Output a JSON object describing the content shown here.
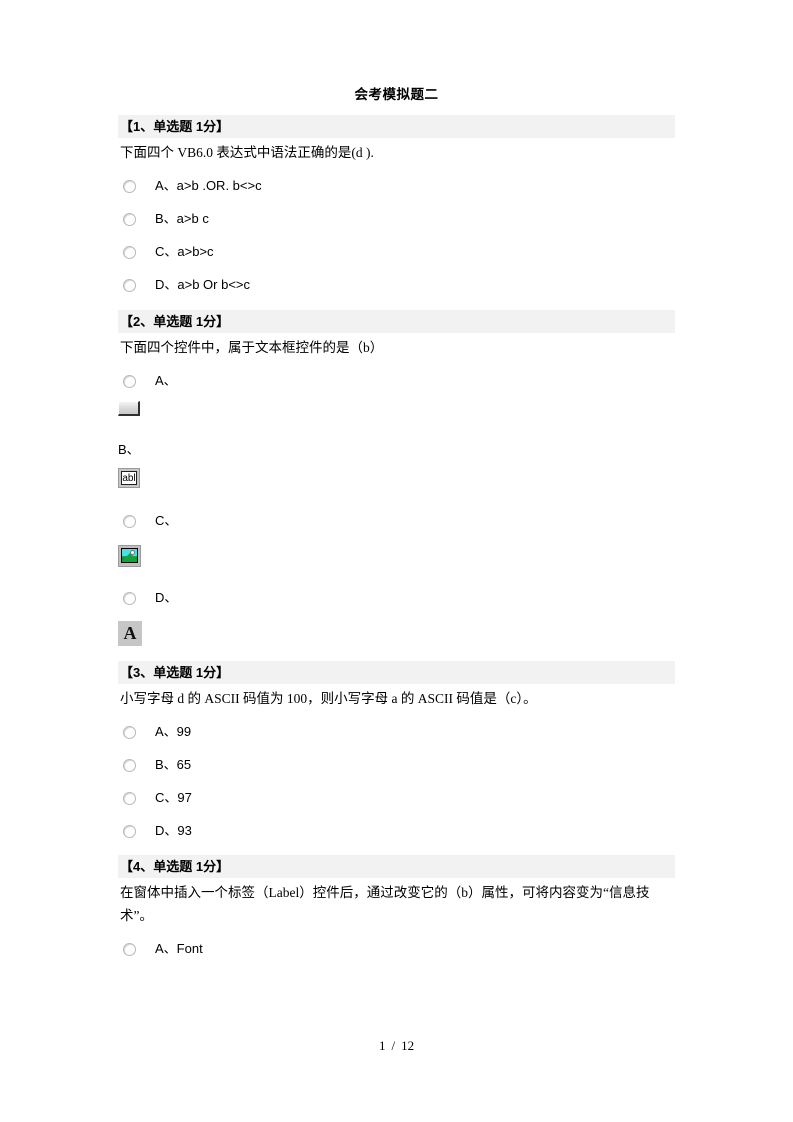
{
  "document": {
    "title": "会考模拟题二",
    "page_footer": {
      "current": "1",
      "separator": "/",
      "total": "12"
    }
  },
  "questions": [
    {
      "header": "【1、单选题 1分】",
      "text": "下面四个 VB6.0 表达式中语法正确的是(d ).",
      "options": [
        {
          "label": "A、a>b .OR. b<>c",
          "type": "radio"
        },
        {
          "label": "B、a>b c",
          "type": "radio"
        },
        {
          "label": "C、a>b>c",
          "type": "radio"
        },
        {
          "label": "D、a>b Or b<>c",
          "type": "radio"
        }
      ]
    },
    {
      "header": "【2、单选题 1分】",
      "text": "下面四个控件中，属于文本框控件的是（b）",
      "options": [
        {
          "label": "A、",
          "type": "radio",
          "icon": "vb-commandbutton-icon"
        },
        {
          "label": "B、",
          "type": "plain",
          "icon": "vb-textbox-icon",
          "icon_text": "abl"
        },
        {
          "label": "C、",
          "type": "radio",
          "icon": "vb-picturebox-icon"
        },
        {
          "label": "D、",
          "type": "radio",
          "icon": "vb-label-icon",
          "icon_text": "A"
        }
      ]
    },
    {
      "header": "【3、单选题 1分】",
      "text": "小写字母 d 的 ASCII 码值为 100，则小写字母 a 的 ASCII 码值是（c）。",
      "options": [
        {
          "label": "A、99",
          "type": "radio"
        },
        {
          "label": "B、65",
          "type": "radio"
        },
        {
          "label": "C、97",
          "type": "radio"
        },
        {
          "label": "D、93",
          "type": "radio"
        }
      ]
    },
    {
      "header": "【4、单选题 1分】",
      "text": "在窗体中插入一个标签（Label）控件后，通过改变它的（b）属性，可将内容变为“信息技术”。",
      "options": [
        {
          "label": "A、Font",
          "type": "radio"
        }
      ]
    }
  ],
  "colors": {
    "header_background": "#f2f2f2",
    "page_background": "#ffffff",
    "text": "#000000"
  }
}
